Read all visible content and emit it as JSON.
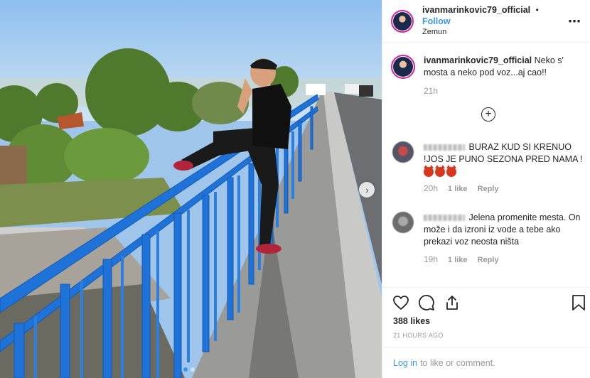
{
  "post": {
    "username": "ivanmarinkovic79_official",
    "separator": "•",
    "follow_label": "Follow",
    "location": "Zemun",
    "more_icon": "⋯"
  },
  "caption": {
    "username": "ivanmarinkovic79_official",
    "text": "Neko s' mosta a neko pod voz...aj cao!!",
    "time": "21h"
  },
  "load_more_icon": "+",
  "comments": [
    {
      "text": "BURAZ KUD SI KRENUO !JOS JE PUNO SEZONA PRED NAMA !",
      "emoji_count": 3,
      "time": "20h",
      "likes": "1 like",
      "reply": "Reply"
    },
    {
      "text": "Jelena promenite mesta. On može i da izroni iz vode a tebe ako prekazi voz neosta ništa",
      "time": "19h",
      "likes": "1 like",
      "reply": "Reply"
    }
  ],
  "engagement": {
    "likes": "388 likes",
    "time_ago": "21 HOURS AGO"
  },
  "login_bar": {
    "link": "Log in",
    "text": "to like or comment."
  },
  "carousel": {
    "next_icon": "›",
    "slide_count": 2,
    "active_slide": 1
  },
  "colors": {
    "accent": "#3897f0",
    "railing": "#1e6fd4",
    "sky": "#9fc6ea"
  }
}
